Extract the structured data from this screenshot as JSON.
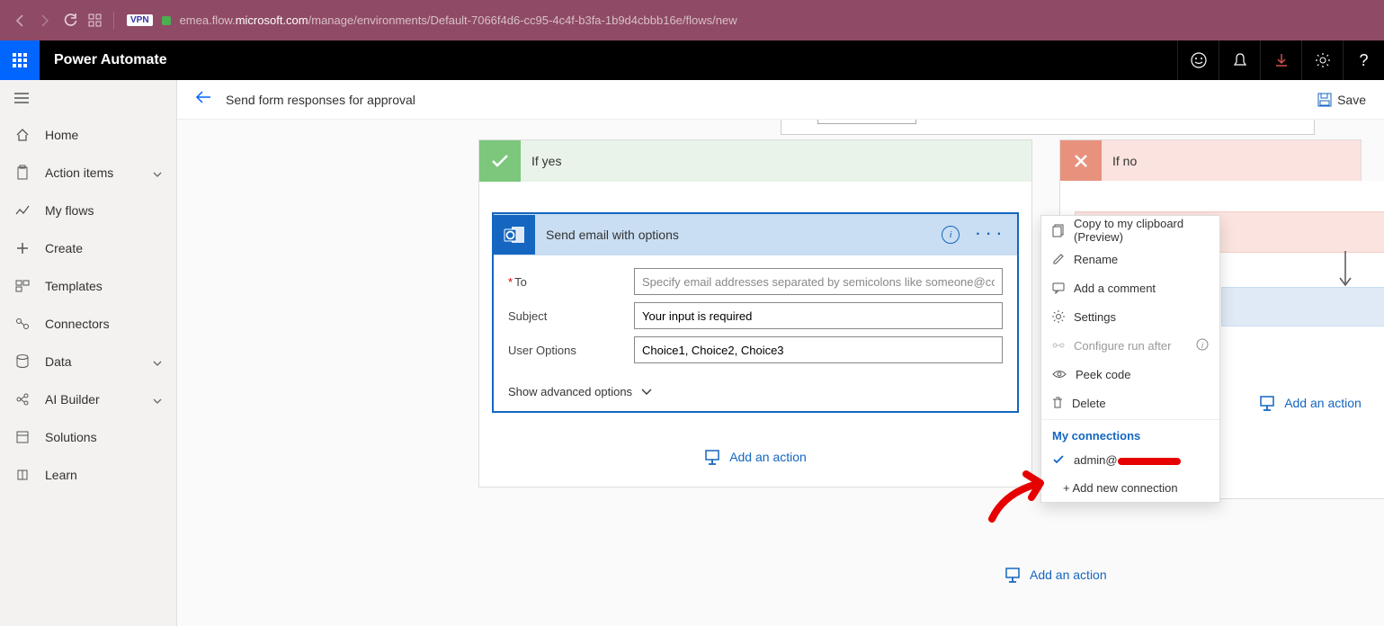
{
  "browser": {
    "url_prefix": "emea.flow.",
    "url_bold": "microsoft.com",
    "url_suffix": "/manage/environments/Default-7066f4d6-cc95-4c4f-b3fa-1b9d4cbbb16e/flows/new",
    "vpn": "VPN"
  },
  "header": {
    "app_name": "Power Automate"
  },
  "sidebar": {
    "items": [
      {
        "label": "Home"
      },
      {
        "label": "Action items",
        "chevron": true
      },
      {
        "label": "My flows"
      },
      {
        "label": "Create"
      },
      {
        "label": "Templates"
      },
      {
        "label": "Connectors"
      },
      {
        "label": "Data",
        "chevron": true
      },
      {
        "label": "AI Builder",
        "chevron": true
      },
      {
        "label": "Solutions"
      },
      {
        "label": "Learn"
      }
    ]
  },
  "toolbar": {
    "title": "Send form responses for approval",
    "save_label": "Save"
  },
  "branches": {
    "yes_title": "If yes",
    "no_title": "If no"
  },
  "action": {
    "title": "Send email with options",
    "to_label": "To",
    "to_placeholder": "Specify email addresses separated by semicolons like someone@contoso.com",
    "subject_label": "Subject",
    "subject_value": "Your input is required",
    "options_label": "User Options",
    "options_value": "Choice1, Choice2, Choice3",
    "advanced": "Show advanced options"
  },
  "add_action_label": "Add an action",
  "context_menu": {
    "copy": "Copy to my clipboard (Preview)",
    "rename": "Rename",
    "comment": "Add a comment",
    "settings": "Settings",
    "configure": "Configure run after",
    "peek": "Peek code",
    "delete": "Delete",
    "connections_heading": "My connections",
    "connection_value": "admin@",
    "add_new": "+ Add new connection"
  }
}
